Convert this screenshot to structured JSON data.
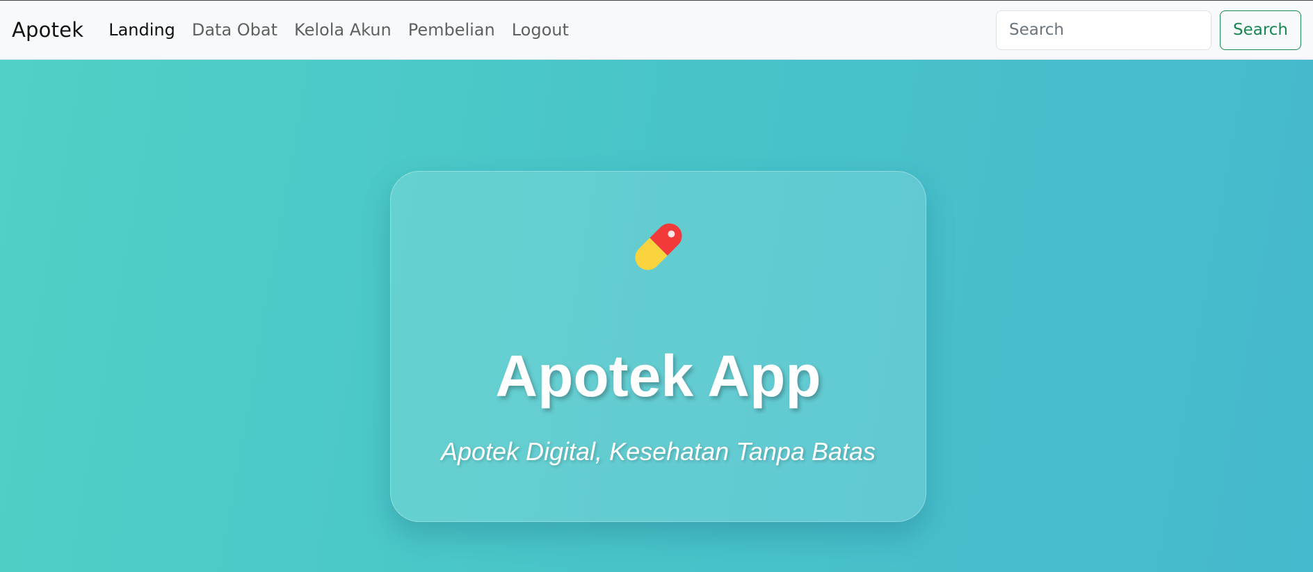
{
  "navbar": {
    "brand": "Apotek",
    "links": [
      {
        "label": "Landing"
      },
      {
        "label": "Data Obat"
      },
      {
        "label": "Kelola Akun"
      },
      {
        "label": "Pembelian"
      },
      {
        "label": "Logout"
      }
    ],
    "search": {
      "placeholder": "Search",
      "button_label": "Search"
    }
  },
  "hero": {
    "icon": "pill-icon",
    "title": "Apotek App",
    "subtitle": "Apotek Digital, Kesehatan Tanpa Batas"
  },
  "colors": {
    "accent": "#198754",
    "gradient_start": "#50d0c6",
    "gradient_end": "#45b9cd",
    "pill_red": "#f23a3a",
    "pill_yellow": "#fad43f"
  }
}
